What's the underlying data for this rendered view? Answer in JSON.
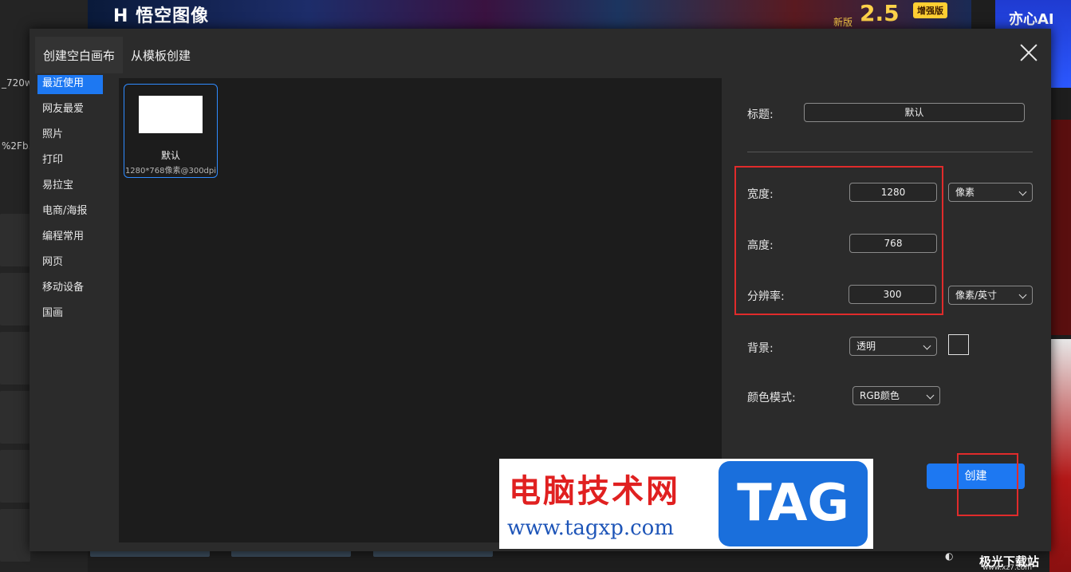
{
  "background": {
    "banner_logo": "H 悟空图像",
    "banner_new": "新版",
    "banner_version": "2.5",
    "banner_badge": "增强版",
    "right_ad_text": "亦心AI",
    "left_texts": [
      "_720w",
      "%2Fb.."
    ]
  },
  "dialog": {
    "tabs": [
      {
        "label": "创建空白画布",
        "active": true
      },
      {
        "label": "从模板创建",
        "active": false
      }
    ],
    "categories": [
      {
        "label": "最近使用",
        "active": true
      },
      {
        "label": "网友最爱"
      },
      {
        "label": "照片"
      },
      {
        "label": "打印"
      },
      {
        "label": "易拉宝"
      },
      {
        "label": "电商/海报"
      },
      {
        "label": "编程常用"
      },
      {
        "label": "网页"
      },
      {
        "label": "移动设备"
      },
      {
        "label": "国画"
      }
    ],
    "template": {
      "name": "默认",
      "meta": "1280*768像素@300dpi"
    },
    "form": {
      "title_label": "标题:",
      "title_value": "默认",
      "width_label": "宽度:",
      "width_value": "1280",
      "height_label": "高度:",
      "height_value": "768",
      "resolution_label": "分辨率:",
      "resolution_value": "300",
      "size_unit": "像素",
      "resolution_unit": "像素/英寸",
      "background_label": "背景:",
      "background_value": "透明",
      "color_mode_label": "颜色模式:",
      "color_mode_value": "RGB颜色"
    },
    "create_label": "创建"
  },
  "watermark": {
    "title": "电脑技术网",
    "url": "www.tagxp.com",
    "tag": "TAG",
    "corner_text": "极光下载站",
    "corner_url": "www.xz7.com"
  },
  "colors": {
    "accent": "#1d78f2",
    "highlight_red": "#e02b2b",
    "dialog_bg": "#2b2b2b",
    "gallery_bg": "#1c1c1c"
  }
}
